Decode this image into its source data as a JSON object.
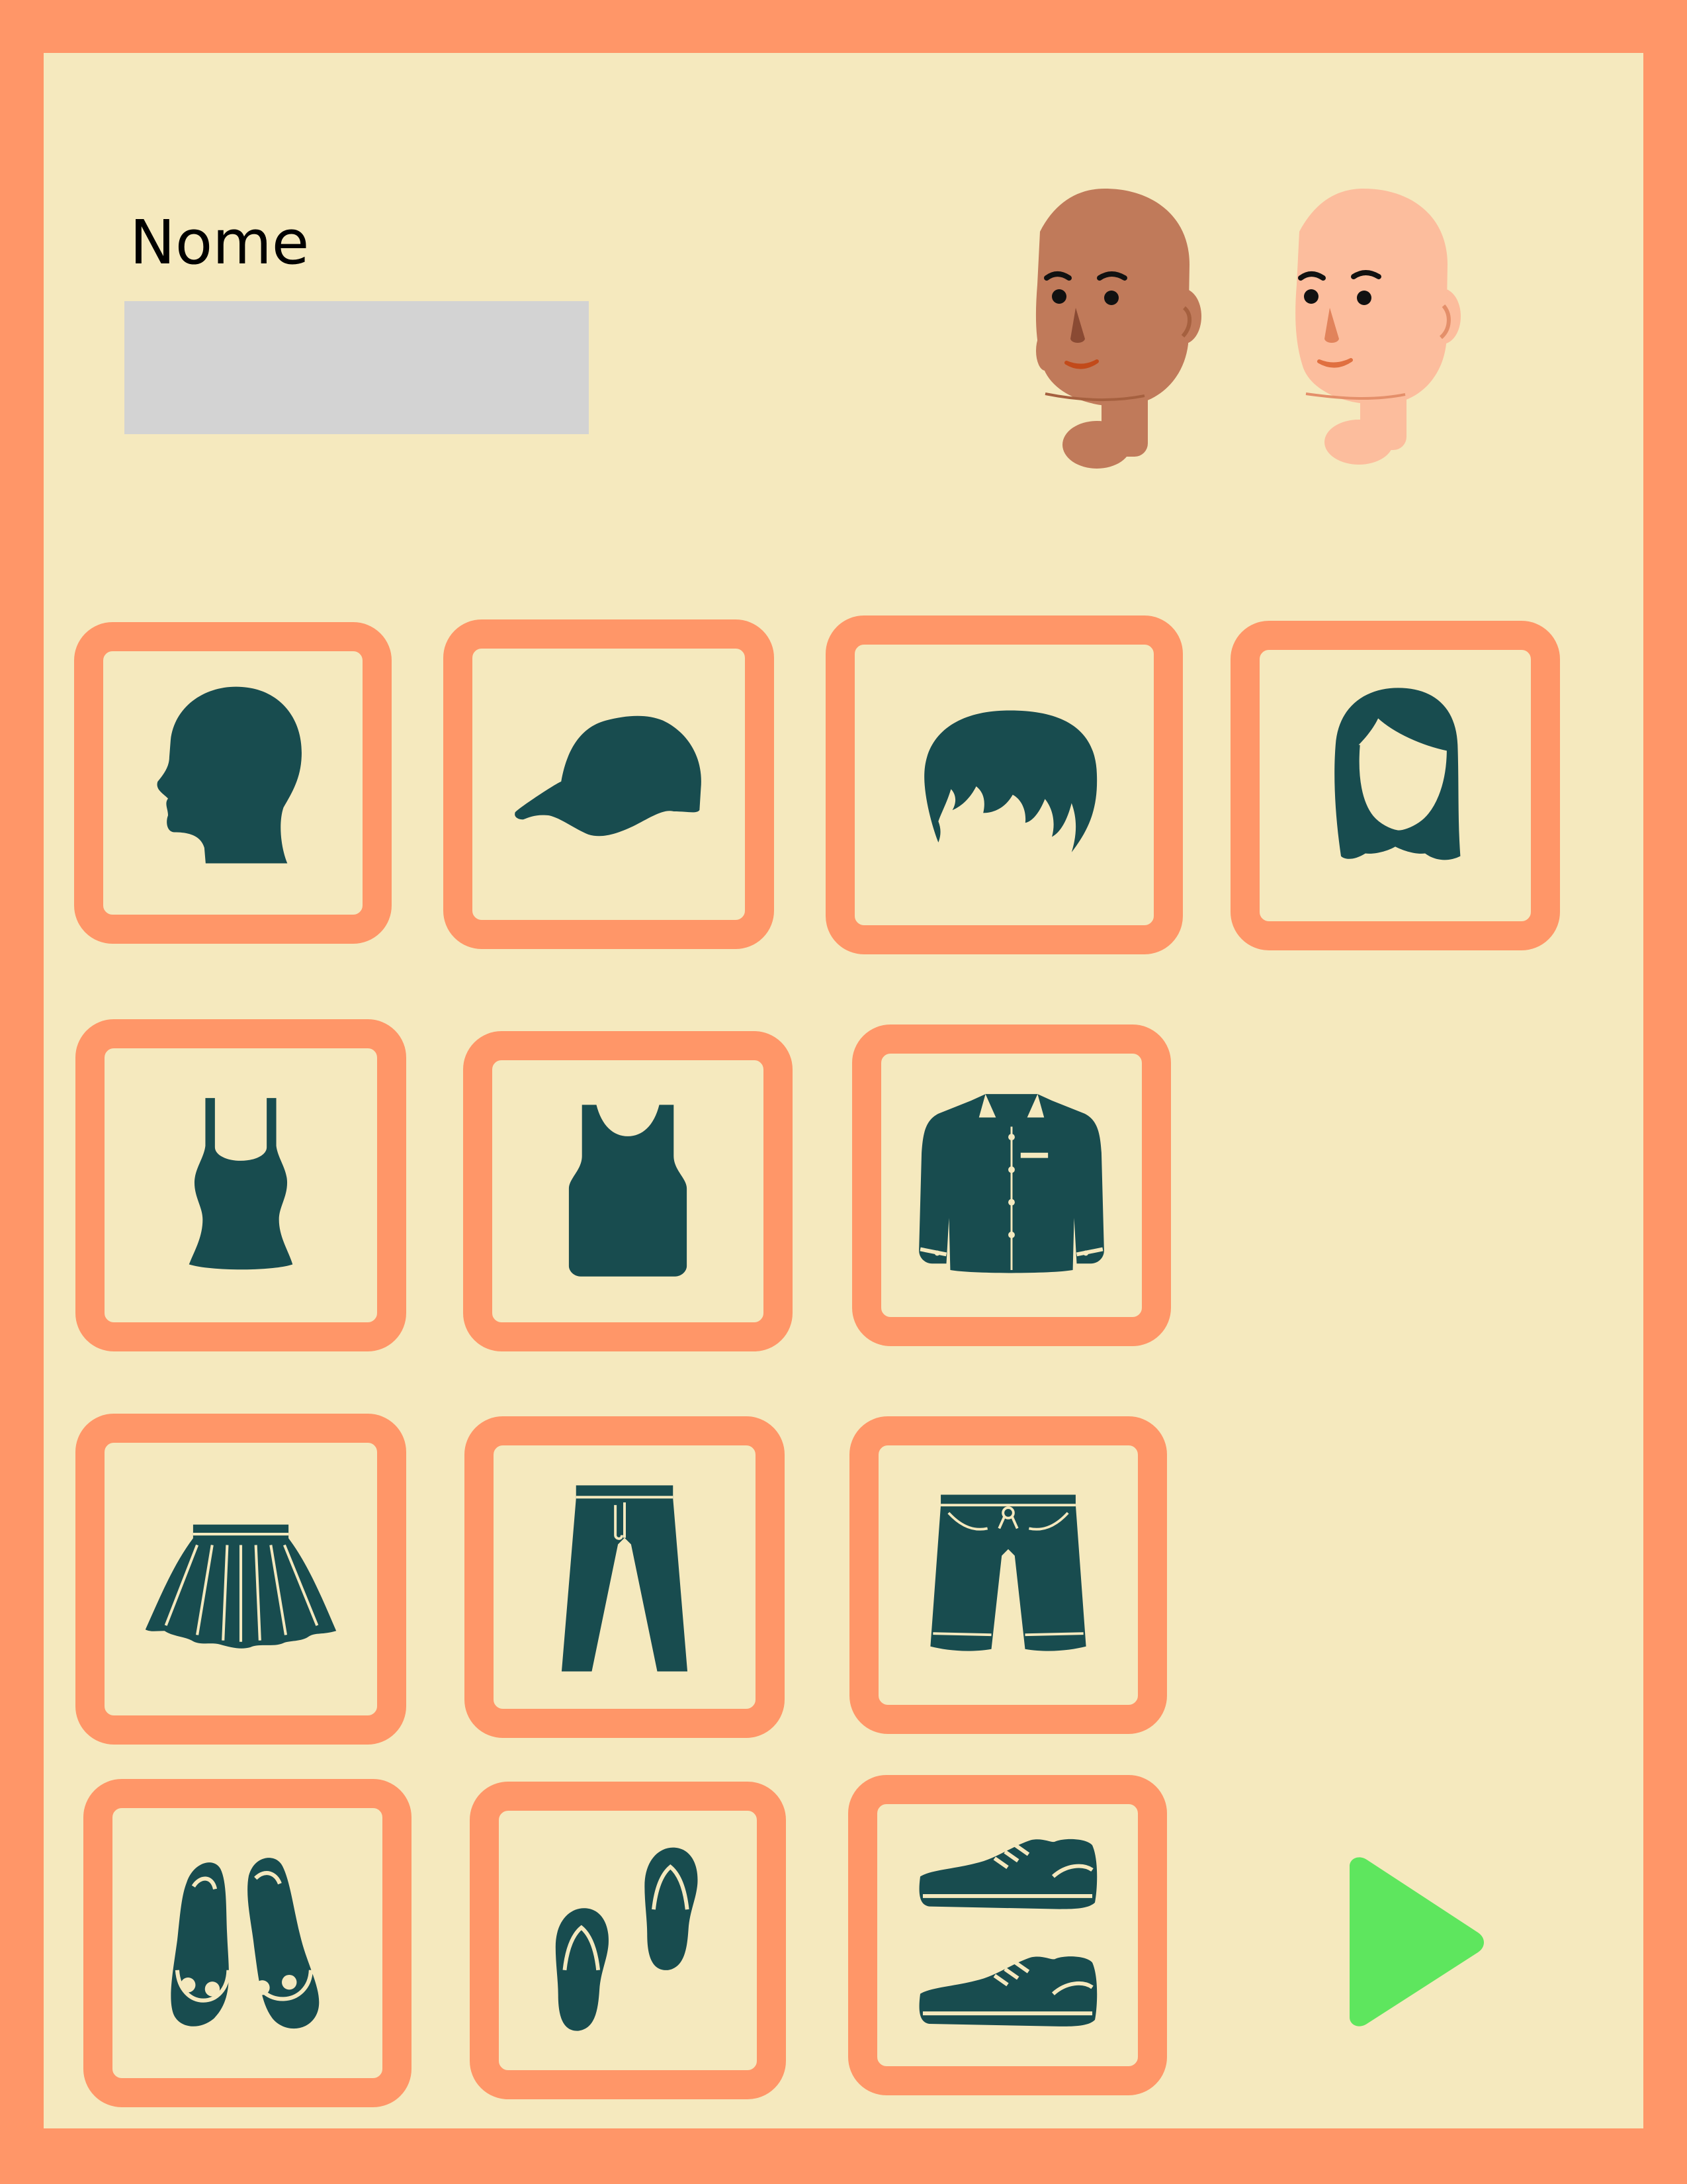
{
  "name_field": {
    "label": "Nome",
    "value": "",
    "placeholder": ""
  },
  "avatars": [
    {
      "icon": "head-dark-skin-icon",
      "skin_color": "#C07A5A"
    },
    {
      "icon": "head-light-skin-icon",
      "skin_color": "#FCBD9D"
    }
  ],
  "options": {
    "head": [
      "bald-head-icon",
      "cap-icon",
      "short-hair-icon",
      "long-hair-icon"
    ],
    "tops": [
      "tank-top-women-icon",
      "tank-top-men-icon",
      "shirt-icon"
    ],
    "bottoms": [
      "skirt-icon",
      "trousers-icon",
      "shorts-icon"
    ],
    "shoes": [
      "sandals-icon",
      "flip-flops-icon",
      "sneakers-icon"
    ]
  },
  "next_button": {
    "icon": "play-arrow-icon",
    "color": "#5EE65E"
  },
  "colors": {
    "frame": "#FF9668",
    "background": "#F5E9BE",
    "icon": "#184C4F",
    "input": "#D3D3D3"
  }
}
